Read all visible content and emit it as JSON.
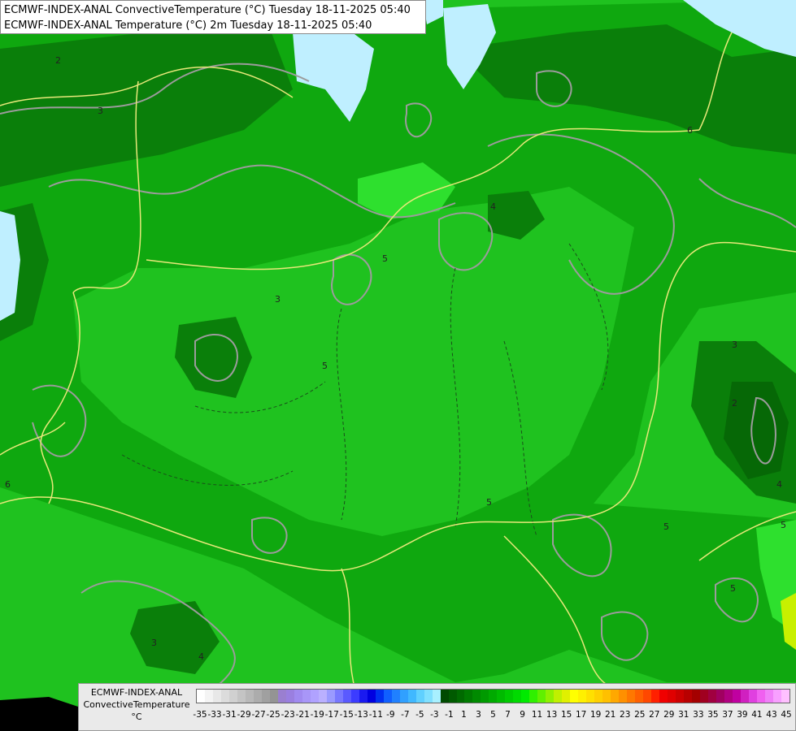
{
  "map": {
    "title_line_1": "ECMWF-INDEX-ANAL ConvectiveTemperature (°C) Tuesday 18-11-2025 05:40",
    "title_line_2": "ECMWF-INDEX-ANAL Temperature (°C) 2m Tuesday 18-11-2025 05:40",
    "contour_labels": [
      "2",
      "3",
      "4",
      "5",
      "6"
    ],
    "colors": {
      "ocean_light": "#bfefff",
      "field_base": "#1fc21f",
      "field_mid": "#0fa80f",
      "field_dark": "#0a7f0a",
      "field_darker": "#066806",
      "field_bright": "#2ee02e",
      "border": "#e8e87a",
      "contour": "#9c9c9c"
    }
  },
  "legend": {
    "name": "ECMWF-INDEX-ANAL",
    "variable": "ConvectiveTemperature",
    "unit": "°C",
    "ticks": [
      "-35",
      "-33",
      "-31",
      "-29",
      "-27",
      "-25",
      "-23",
      "-21",
      "-19",
      "-17",
      "-15",
      "-13",
      "-11",
      "-9",
      "-7",
      "-5",
      "-3",
      "-1",
      "1",
      "3",
      "5",
      "7",
      "9",
      "11",
      "13",
      "15",
      "17",
      "19",
      "21",
      "23",
      "25",
      "27",
      "29",
      "31",
      "33",
      "35",
      "37",
      "39",
      "41",
      "43",
      "45"
    ],
    "colors": [
      "#ffffff",
      "#f4f4f4",
      "#e8e8e8",
      "#dcdcdc",
      "#d0d0d0",
      "#c4c4c4",
      "#b8b8b8",
      "#acacac",
      "#a0a0a0",
      "#949494",
      "#9a7fd0",
      "#9a7fe0",
      "#a08af0",
      "#a896f8",
      "#b0a2ff",
      "#bab0ff",
      "#9a9aff",
      "#7878ff",
      "#5a5aff",
      "#3c3cff",
      "#1a1af0",
      "#0000e0",
      "#0030f0",
      "#1060ff",
      "#2080ff",
      "#30a0ff",
      "#40b8ff",
      "#60d0ff",
      "#80e0ff",
      "#a8f0ff",
      "#004a00",
      "#005a00",
      "#006a00",
      "#007a00",
      "#008a00",
      "#009a00",
      "#00aa00",
      "#00ba00",
      "#00ca00",
      "#00da00",
      "#00ea00",
      "#30f000",
      "#60f000",
      "#90f000",
      "#c0f000",
      "#e0f000",
      "#ffff00",
      "#fff000",
      "#ffe000",
      "#ffd000",
      "#ffc000",
      "#ffa800",
      "#ff9000",
      "#ff7800",
      "#ff6000",
      "#ff4800",
      "#ff2000",
      "#f00000",
      "#e00000",
      "#cc0000",
      "#b80000",
      "#a40000",
      "#a00020",
      "#a00040",
      "#a00060",
      "#b00080",
      "#c000a0",
      "#d020c0",
      "#e040e0",
      "#f060f0",
      "#f080f8",
      "#f8a0ff",
      "#ffc0ff"
    ]
  }
}
